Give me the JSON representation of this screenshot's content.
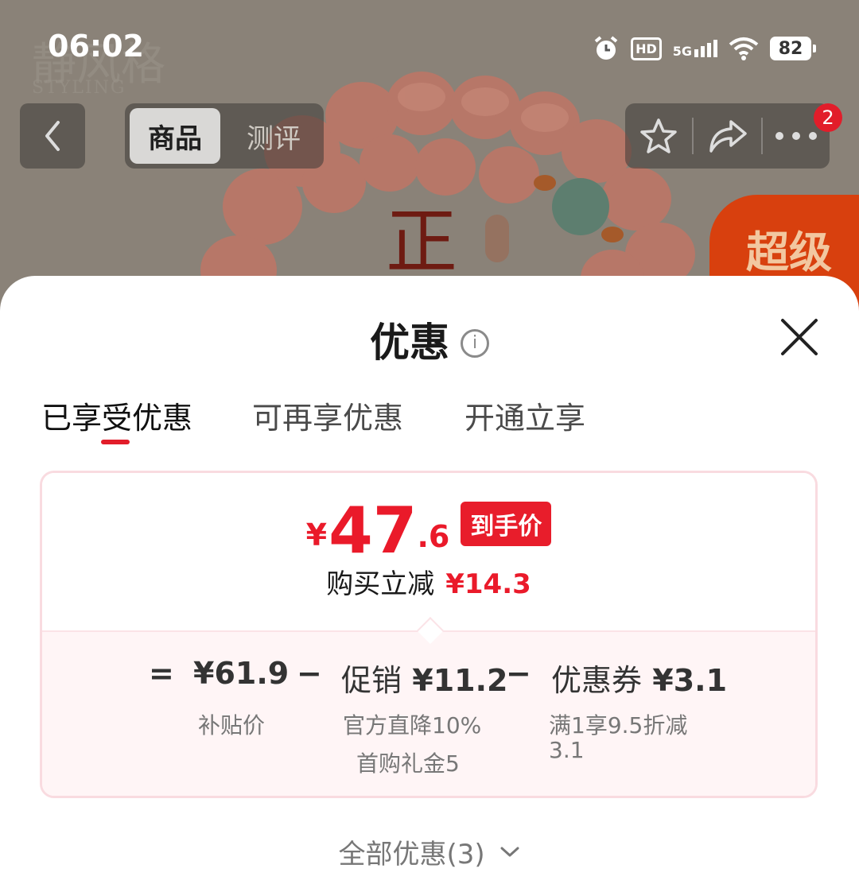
{
  "status_bar": {
    "time": "06:02",
    "hd": "HD",
    "network": "5G",
    "battery": "82"
  },
  "background": {
    "brand_text": "静风格",
    "brand_sub": "STYLING",
    "promo_tag": "超级"
  },
  "nav": {
    "tabs": [
      "商品",
      "测评"
    ],
    "active_tab": 0,
    "notification_count": "2"
  },
  "sheet": {
    "title": "优惠",
    "tabs": [
      "已享受优惠",
      "可再享优惠",
      "开通立享"
    ],
    "active_tab": 0,
    "final_price": {
      "currency": "¥",
      "integer": "47",
      "decimal": ".6",
      "tag": "到手价"
    },
    "reduction": {
      "label": "购买立减",
      "value": "¥14.3"
    },
    "formula": {
      "equals": "=",
      "minus": "−",
      "base_price": "¥61.9",
      "base_label": "补贴价",
      "promo_label": "促销",
      "promo_value": "¥11.2",
      "promo_details": [
        "官方直降10%",
        "首购礼金5"
      ],
      "coupon_label": "优惠券",
      "coupon_value": "¥3.1",
      "coupon_detail_lines": [
        "满1享9.5折减",
        "3.1"
      ]
    },
    "all_offers": "全部优惠(3)"
  },
  "colors": {
    "accent_red": "#E21D2A",
    "card_border": "#F9DBE0",
    "card_tint": "#FFF5F6"
  }
}
